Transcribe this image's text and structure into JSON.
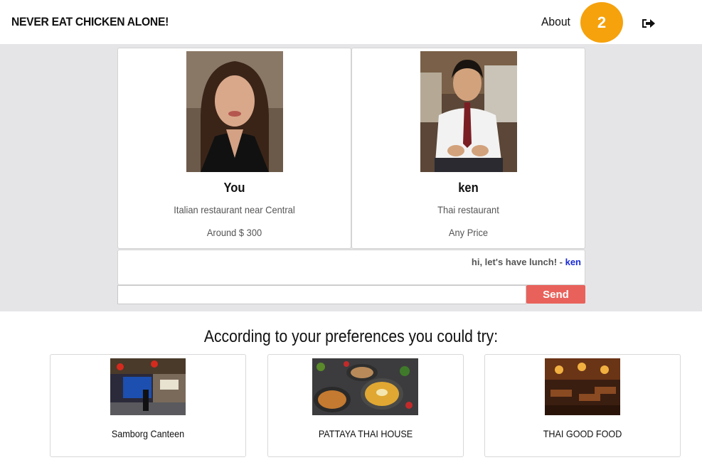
{
  "header": {
    "brand": "NEVER EAT CHICKEN ALONE!",
    "about_label": "About",
    "notification_count": "2",
    "logout_icon": "sign-out-icon"
  },
  "match": {
    "you": {
      "name": "You",
      "preference": "Italian restaurant near Central",
      "price": "Around $ 300"
    },
    "partner": {
      "name": "ken",
      "preference": "Thai restaurant",
      "price": "Any Price"
    }
  },
  "chat": {
    "message_text": "hi, let's have lunch!",
    "separator": " - ",
    "message_author": "ken",
    "input_value": "",
    "send_label": "Send"
  },
  "recommendations": {
    "heading": "According to your preferences you could try:",
    "items": [
      {
        "name": "Samborg Canteen"
      },
      {
        "name": "PATTAYA THAI HOUSE"
      },
      {
        "name": "THAI GOOD FOOD"
      }
    ]
  },
  "colors": {
    "badge": "#f5a20d",
    "send_button": "#e8625b",
    "band_background": "#e5e5e8",
    "author_link": "#1a2bd4"
  }
}
